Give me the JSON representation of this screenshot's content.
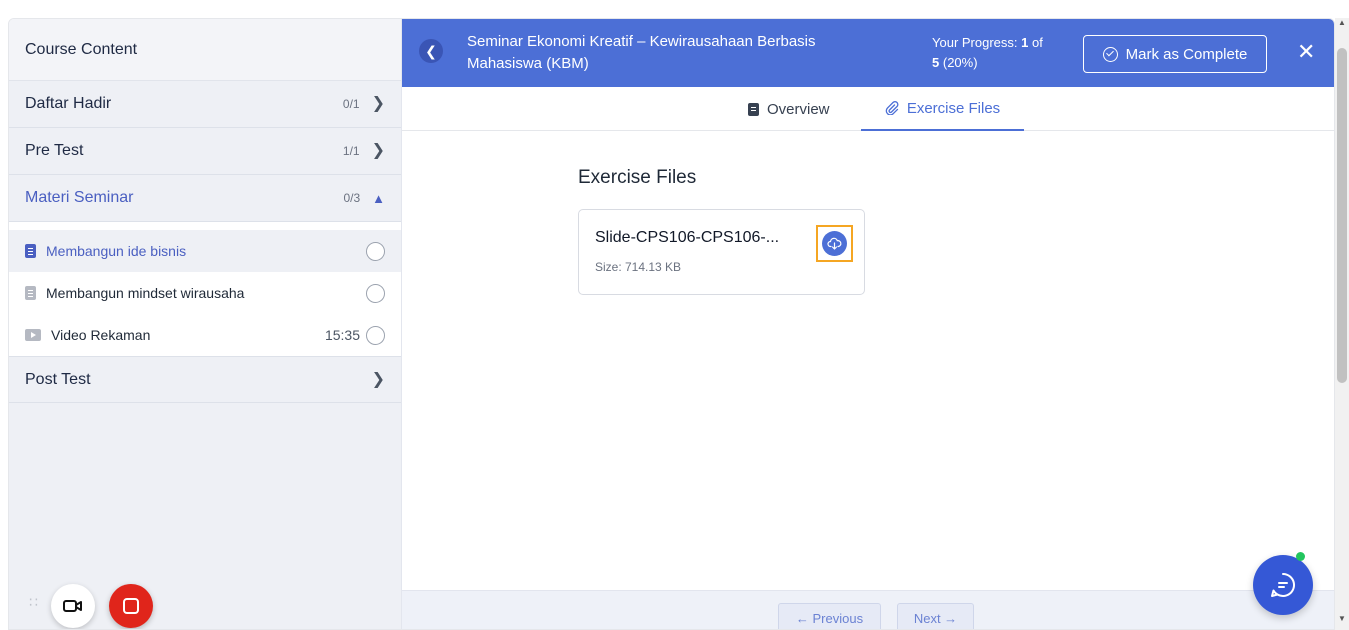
{
  "sidebar": {
    "header": "Course Content",
    "sections": [
      {
        "title": "Daftar Hadir",
        "count": "0/1",
        "chevron": ">"
      },
      {
        "title": "Pre Test",
        "count": "1/1",
        "chevron": ">"
      },
      {
        "title": "Materi Seminar",
        "count": "0/3",
        "chevron": "^"
      }
    ],
    "lessons": [
      {
        "title": "Membangun ide bisnis",
        "duration": "",
        "icon": "document-icon"
      },
      {
        "title": "Membangun mindset wirausaha",
        "duration": "",
        "icon": "document-icon"
      },
      {
        "title": "Video Rekaman",
        "duration": "15:35",
        "icon": "video-icon"
      }
    ],
    "post_test": {
      "title": "Post Test",
      "chevron": ">"
    }
  },
  "topbar": {
    "course_title": "Seminar Ekonomi Kreatif – Kewirausahaan Berbasis Mahasiswa (KBM)",
    "progress_label": "Your Progress:",
    "progress_current": "1",
    "progress_of": "of",
    "progress_total": "5",
    "progress_percent": "(20%)",
    "mark_complete": "Mark as Complete",
    "close": "✕",
    "back": "<"
  },
  "tabs": {
    "overview": "Overview",
    "exercise_files": "Exercise Files"
  },
  "content": {
    "title": "Exercise Files",
    "file_name": "Slide-CPS106-CPS106-...",
    "file_size": "Size: 714.13 KB"
  },
  "footer": {
    "previous": "← Previous",
    "next": "Next →"
  },
  "colors": {
    "accent": "#4c6fd6",
    "record": "#e0251b",
    "highlight": "#f5a623",
    "online": "#22c55e"
  }
}
